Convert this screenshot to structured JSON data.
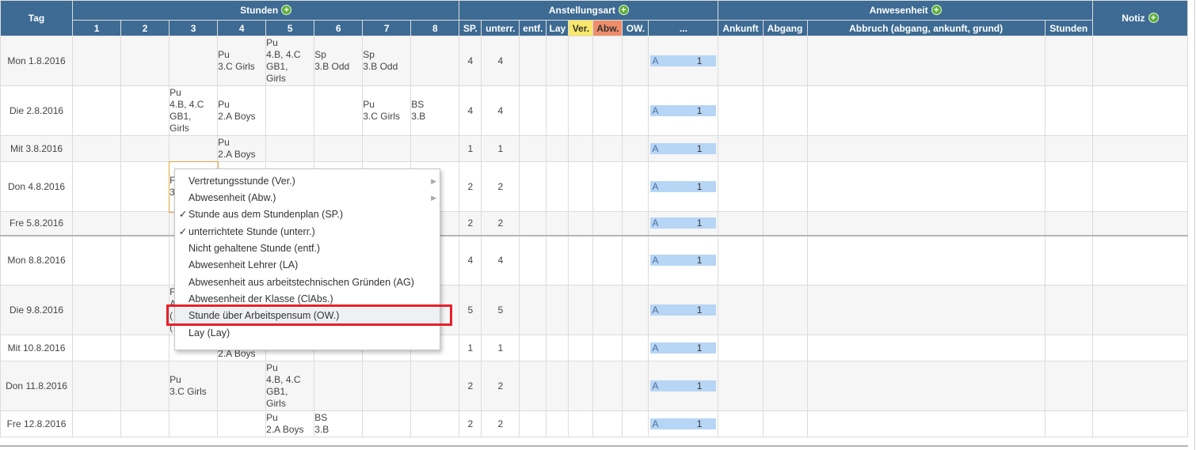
{
  "header": {
    "tag": "Tag",
    "stunden": "Stunden",
    "anstellungsart": "Anstellungsart",
    "anwesenheit": "Anwesenheit",
    "notiz": "Notiz",
    "plus": "+",
    "lessons": [
      "1",
      "2",
      "3",
      "4",
      "5",
      "6",
      "7",
      "8"
    ],
    "sp": "SP.",
    "unterr": "unterr.",
    "entf": "entf.",
    "lay": "Lay",
    "ver": "Ver.",
    "abw": "Abw.",
    "ow": "OW.",
    "dots": "...",
    "ankunft": "Ankunft",
    "abgang": "Abgang",
    "abbruch": "Abbruch (abgang, ankunft, grund)",
    "stunden_col": "Stunden",
    "colors": {
      "header_bg": "#3d6b93",
      "ver": "#f8e76a",
      "abw": "#ef8c6a",
      "plus": "#5cae3a"
    }
  },
  "rows": [
    {
      "day": "Mon 1.8.2016",
      "l": [
        "",
        "",
        "",
        "Pu\n3.C Girls",
        "Pu\n4.B, 4.C\nGB1,\nGirls",
        "Sp\n3.B Odd",
        "Sp\n3.B Odd",
        ""
      ],
      "sp": "4",
      "unterr": "4",
      "a": "A",
      "aval": "1"
    },
    {
      "day": "Die 2.8.2016",
      "l": [
        "",
        "",
        "Pu\n4.B, 4.C\nGB1,\nGirls",
        "Pu\n2.A Boys",
        "",
        "",
        "Pu\n3.C Girls",
        "BS\n3.B"
      ],
      "sp": "4",
      "unterr": "4",
      "a": "A",
      "aval": "1"
    },
    {
      "day": "Mit 3.8.2016",
      "l": [
        "",
        "",
        "",
        "Pu\n2.A Boys",
        "",
        "",
        "",
        ""
      ],
      "sp": "1",
      "unterr": "1",
      "a": "A",
      "aval": "1"
    },
    {
      "day": "Don 4.8.2016",
      "l": [
        "",
        "",
        "F\n3",
        "",
        "",
        "",
        "",
        ""
      ],
      "sp": "2",
      "unterr": "2",
      "a": "A",
      "aval": "1"
    },
    {
      "day": "Fre 5.8.2016",
      "l": [
        "",
        "",
        "",
        "",
        "",
        "",
        "",
        ""
      ],
      "sp": "2",
      "unterr": "2",
      "a": "A",
      "aval": "1"
    },
    {
      "day": "Mon 8.8.2016",
      "l": [
        "",
        "",
        "",
        "",
        "",
        "",
        "",
        ""
      ],
      "sp": "4",
      "unterr": "4",
      "a": "A",
      "aval": "1"
    },
    {
      "day": "Die 9.8.2016",
      "l": [
        "",
        "",
        "F\nA\n(\n(",
        "",
        "",
        "",
        "",
        ""
      ],
      "sp": "5",
      "unterr": "5",
      "a": "A",
      "aval": "1"
    },
    {
      "day": "Mit 10.8.2016",
      "l": [
        "",
        "",
        "",
        "Pu\n2.A Boys",
        "",
        "",
        "",
        ""
      ],
      "sp": "1",
      "unterr": "1",
      "a": "A",
      "aval": "1"
    },
    {
      "day": "Don 11.8.2016",
      "l": [
        "",
        "",
        "Pu\n3.C Girls",
        "",
        "Pu\n4.B, 4.C\nGB1,\nGirls",
        "",
        "",
        ""
      ],
      "sp": "2",
      "unterr": "2",
      "a": "A",
      "aval": "1"
    },
    {
      "day": "Fre 12.8.2016",
      "l": [
        "",
        "",
        "",
        "",
        "Pu\n2.A Boys",
        "BS\n3.B",
        "",
        ""
      ],
      "sp": "2",
      "unterr": "2",
      "a": "A",
      "aval": "1"
    }
  ],
  "context_menu": {
    "items": [
      {
        "label": "Vertretungsstunde (Ver.)",
        "check": "",
        "submenu": "▶"
      },
      {
        "label": "Abwesenheit (Abw.)",
        "check": "",
        "submenu": "▶"
      },
      {
        "label": "Stunde aus dem Stundenplan (SP.)",
        "check": "✓",
        "submenu": ""
      },
      {
        "label": "unterrichtete Stunde (unterr.)",
        "check": "✓",
        "submenu": ""
      },
      {
        "label": "Nicht gehaltene Stunde (entf.)",
        "check": "",
        "submenu": ""
      },
      {
        "label": "Abwesenheit Lehrer (LA)",
        "check": "",
        "submenu": ""
      },
      {
        "label": "Abwesenheit aus arbeitstechnischen Gründen (AG)",
        "check": "",
        "submenu": ""
      },
      {
        "label": "Abwesenheit der Klasse (ClAbs.)",
        "check": "",
        "submenu": ""
      },
      {
        "label": "Stunde über Arbeitspensum (OW.)",
        "check": "",
        "submenu": ""
      },
      {
        "label": "Lay (Lay)",
        "check": "",
        "submenu": ""
      }
    ]
  }
}
